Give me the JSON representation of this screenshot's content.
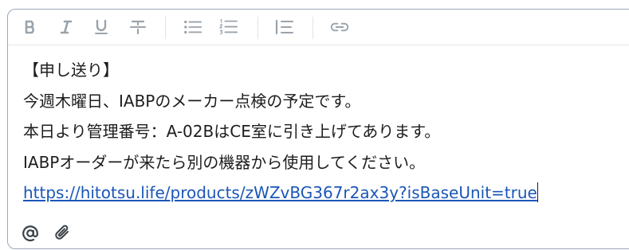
{
  "toolbar": {
    "buttons": [
      {
        "name": "bold",
        "icon": "bold-icon"
      },
      {
        "name": "italic",
        "icon": "italic-icon"
      },
      {
        "name": "underline",
        "icon": "underline-icon"
      },
      {
        "name": "strikethrough",
        "icon": "strikethrough-icon"
      },
      {
        "name": "bullet-list",
        "icon": "bullet-list-icon"
      },
      {
        "name": "numbered-list",
        "icon": "numbered-list-icon"
      },
      {
        "name": "blockquote",
        "icon": "blockquote-icon"
      },
      {
        "name": "link",
        "icon": "link-icon"
      }
    ],
    "icon_color": "#9aa3ab"
  },
  "editor": {
    "lines": [
      "【申し送り】",
      "今週木曜日、IABPのメーカー点検の予定です。",
      "本日より管理番号：A-02BはCE室に引き上げてあります。",
      "IABPオーダーが来たら別の機器から使用してください。"
    ],
    "link": "https://hitotsu.life/products/zWZvBG367r2ax3y?isBaseUnit=true",
    "link_color": "#1a56b8",
    "text_color": "#1d1d1d"
  },
  "footer": {
    "buttons": [
      {
        "name": "mention",
        "icon": "at-icon"
      },
      {
        "name": "attach",
        "icon": "paperclip-icon"
      }
    ],
    "icon_color": "#3b4249"
  }
}
